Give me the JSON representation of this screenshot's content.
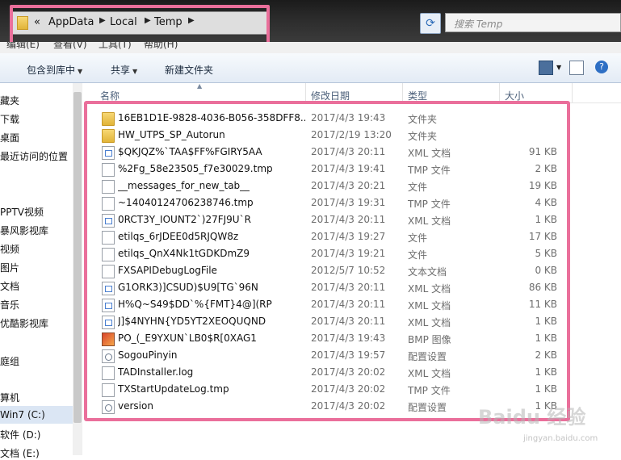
{
  "address": {
    "overflow": "«",
    "crumbs": [
      "AppData",
      "Local",
      "Temp"
    ]
  },
  "search": {
    "placeholder": "搜索 Temp"
  },
  "menubar": {
    "items": [
      "编辑(E)",
      "查看(V)",
      "工具(T)",
      "帮助(H)"
    ]
  },
  "toolbar": {
    "include_label": "包含到库中",
    "share_label": "共享",
    "new_folder_label": "新建文件夹"
  },
  "nav": {
    "items": [
      "藏夹",
      "下载",
      "桌面",
      "最近访问的位置",
      "PPTV视频",
      "暴风影视库",
      "视频",
      "图片",
      "文档",
      "音乐",
      "优酷影视库",
      "庭组",
      "算机",
      "Win7 (C:)",
      "软件 (D:)",
      "文档 (E:)"
    ]
  },
  "columns": {
    "name": "名称",
    "date": "修改日期",
    "type": "类型",
    "size": "大小"
  },
  "files": [
    {
      "name": "16EB1D1E-9828-4036-B056-358DFF8...",
      "date": "2017/4/3 19:43",
      "type": "文件夹",
      "size": "",
      "icon": "folder-icon"
    },
    {
      "name": "HW_UTPS_SP_Autorun",
      "date": "2017/2/19 13:20",
      "type": "文件夹",
      "size": "",
      "icon": "folder-icon"
    },
    {
      "name": "$QKJQZ%`TAA$FF%FGIRY5AA",
      "date": "2017/4/3 20:11",
      "type": "XML 文档",
      "size": "91 KB",
      "icon": "xml-file-icon"
    },
    {
      "name": "%2Fg_58e23505_f7e30029.tmp",
      "date": "2017/4/3 19:41",
      "type": "TMP 文件",
      "size": "2 KB",
      "icon": "file-icon"
    },
    {
      "name": "__messages_for_new_tab__",
      "date": "2017/4/3 20:21",
      "type": "文件",
      "size": "19 KB",
      "icon": "file-icon"
    },
    {
      "name": "~14040124706238746.tmp",
      "date": "2017/4/3 19:31",
      "type": "TMP 文件",
      "size": "4 KB",
      "icon": "file-icon"
    },
    {
      "name": "0RCT3Y_IOUNT2`)27FJ9U`R",
      "date": "2017/4/3 20:11",
      "type": "XML 文档",
      "size": "1 KB",
      "icon": "xml-file-icon"
    },
    {
      "name": "etilqs_6rJDEE0d5RJQW8z",
      "date": "2017/4/3 19:27",
      "type": "文件",
      "size": "17 KB",
      "icon": "file-icon"
    },
    {
      "name": "etilqs_QnX4Nk1tGDKDmZ9",
      "date": "2017/4/3 19:21",
      "type": "文件",
      "size": "5 KB",
      "icon": "file-icon"
    },
    {
      "name": "FXSAPIDebugLogFile",
      "date": "2012/5/7 10:52",
      "type": "文本文档",
      "size": "0 KB",
      "icon": "file-icon"
    },
    {
      "name": "G1ORK3)]CSUD)$U9[TG`96N",
      "date": "2017/4/3 20:11",
      "type": "XML 文档",
      "size": "86 KB",
      "icon": "xml-file-icon"
    },
    {
      "name": "H%Q~S49$DD`%{FMT}4@](RP",
      "date": "2017/4/3 20:11",
      "type": "XML 文档",
      "size": "11 KB",
      "icon": "xml-file-icon"
    },
    {
      "name": "J]$4NYHN{YD5YT2XEOQUQND",
      "date": "2017/4/3 20:11",
      "type": "XML 文档",
      "size": "1 KB",
      "icon": "xml-file-icon"
    },
    {
      "name": "PO_(_E9YXUN`LB0$R[0XAG1",
      "date": "2017/4/3 19:43",
      "type": "BMP 图像",
      "size": "1 KB",
      "icon": "bmp-image-icon"
    },
    {
      "name": "SogouPinyin",
      "date": "2017/4/3 19:57",
      "type": "配置设置",
      "size": "2 KB",
      "icon": "config-file-icon"
    },
    {
      "name": "TADInstaller.log",
      "date": "2017/4/3 20:02",
      "type": "XML 文档",
      "size": "1 KB",
      "icon": "file-icon"
    },
    {
      "name": "TXStartUpdateLog.tmp",
      "date": "2017/4/3 20:02",
      "type": "TMP 文件",
      "size": "1 KB",
      "icon": "file-icon"
    },
    {
      "name": "version",
      "date": "2017/4/3 20:02",
      "type": "配置设置",
      "size": "1 KB",
      "icon": "config-file-icon"
    }
  ],
  "watermark": {
    "brand": "Baidu 经验",
    "url": "jingyan.baidu.com"
  },
  "colors": {
    "highlight": "#ea6f9b",
    "folder": "#e1b438",
    "header_text": "#4c607a"
  }
}
